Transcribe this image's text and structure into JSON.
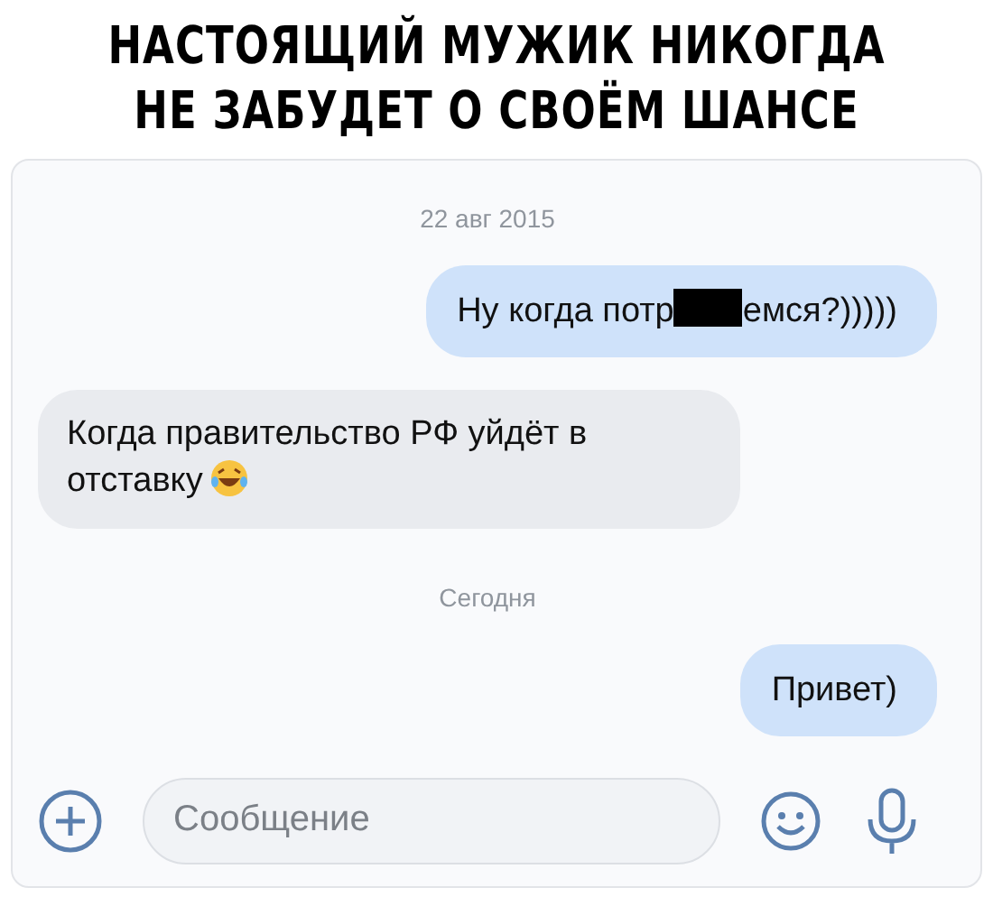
{
  "caption": [
    "НАСТОЯЩИЙ МУЖИК НИКОГДА",
    "НЕ ЗАБУДЕТ О СВОЁМ ШАНСЕ"
  ],
  "messages": [
    {
      "kind": "date",
      "text": "22 авг 2015"
    },
    {
      "kind": "out",
      "parts": [
        {
          "kind": "text",
          "text": "Ну когда потр"
        },
        {
          "kind": "censor"
        },
        {
          "kind": "text",
          "text": "емся?)))))"
        }
      ]
    },
    {
      "kind": "in",
      "parts": [
        {
          "kind": "text",
          "text": "Когда правительство РФ уйдёт в отставку"
        },
        {
          "kind": "emoji"
        }
      ]
    },
    {
      "kind": "date",
      "text": "Сегодня"
    },
    {
      "kind": "out",
      "parts": [
        {
          "kind": "text",
          "text": "Привет)"
        }
      ]
    }
  ],
  "composer": {
    "placeholder": "Сообщение"
  }
}
